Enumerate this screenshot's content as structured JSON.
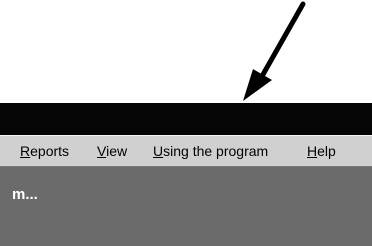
{
  "menu": {
    "items": [
      {
        "accel": "R",
        "rest": "eports"
      },
      {
        "accel": "V",
        "rest": "iew"
      },
      {
        "accel": "U",
        "rest": "sing the program"
      },
      {
        "accel": "H",
        "rest": "elp"
      }
    ]
  },
  "window": {
    "partial_text": "m..."
  },
  "colors": {
    "title_bar": "#050505",
    "menu_bar": "#d0d0d0",
    "client_area": "#6b6b6b",
    "arrow": "#000000"
  },
  "icons": {
    "pointer": "arrow-pointer-icon"
  }
}
